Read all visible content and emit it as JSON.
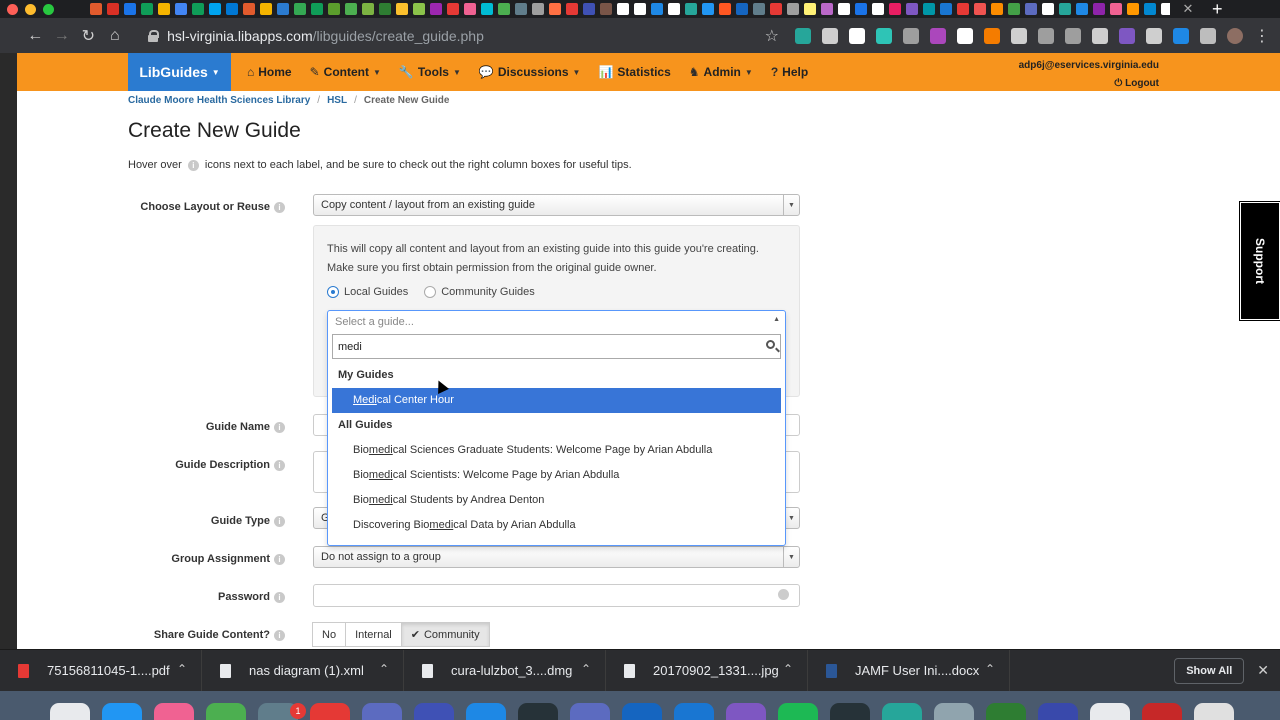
{
  "browser": {
    "url_host": "hsl-virginia.libapps.com",
    "url_path": "/libguides/create_guide.php",
    "tab_favicon_colors": [
      "#e25b2d",
      "#d93025",
      "#1a73e8",
      "#0f9d58",
      "#f4b400",
      "#4285f4",
      "#0f9d58",
      "#00a4ef",
      "#0078d4",
      "#e25b2d",
      "#f4b400",
      "#2b7bd0",
      "#34a853",
      "#0f9d58",
      "#5b9e2c",
      "#4caf50",
      "#7cb342",
      "#2e7d32",
      "#fbc02d",
      "#8bc34a",
      "#9c27b0",
      "#e53935",
      "#f06292",
      "#00bcd4",
      "#4caf50",
      "#607d8b",
      "#9e9e9e",
      "#ff7043",
      "#e53935",
      "#3f51b5",
      "#795548",
      "#ffffff",
      "#ffffff",
      "#1e88e5",
      "#ffffff",
      "#26a69a",
      "#2196f3",
      "#ff5722",
      "#1565c0",
      "#607d8b",
      "#e53935",
      "#9e9e9e",
      "#fff176",
      "#ba68c8",
      "#ffffff",
      "#1a73e8",
      "#ffffff",
      "#e91e63",
      "#7e57c2",
      "#0097a7",
      "#1976d2",
      "#e53935",
      "#ef5350",
      "#fb8c00",
      "#43a047",
      "#5c6bc0",
      "#ffffff",
      "#26a69a",
      "#1e88e5",
      "#8e24aa",
      "#f06292",
      "#ff9800",
      "#0288d1",
      "#ffffff",
      "#1e88e5",
      "#1a73e8",
      "#00897b",
      "#ffffff",
      "#ef5350",
      "#2e7d32",
      "#d32f2f",
      "#ffffff",
      "#5c6bc0"
    ],
    "extension_colors": [
      "#26a69a",
      "#cfcfcf",
      "#ffffff",
      "#2ec4b6",
      "#9e9e9e",
      "#ab47bc",
      "#ffffff",
      "#f57c00",
      "#cfcfcf",
      "#9e9e9e",
      "#9e9e9e",
      "#cfcfcf",
      "#7e57c2",
      "#cfcfcf",
      "#1e88e5",
      "#bdbdbd"
    ]
  },
  "navbar": {
    "brand": "LibGuides",
    "items": [
      {
        "icon": "home-icon",
        "glyph": "⌂",
        "label": "Home",
        "caret": false
      },
      {
        "icon": "content-icon",
        "glyph": "✎",
        "label": "Content",
        "caret": true
      },
      {
        "icon": "wrench-icon",
        "glyph": "🔧",
        "label": "Tools",
        "caret": true
      },
      {
        "icon": "discussions-icon",
        "glyph": "💬",
        "label": "Discussions",
        "caret": true
      },
      {
        "icon": "statistics-icon",
        "glyph": "📊",
        "label": "Statistics",
        "caret": false
      },
      {
        "icon": "admin-icon",
        "glyph": "♞",
        "label": "Admin",
        "caret": true
      },
      {
        "icon": "help-icon",
        "glyph": "?",
        "label": "Help",
        "caret": false
      }
    ],
    "user_email": "adp6j@eservices.virginia.edu",
    "logout": "Logout"
  },
  "breadcrumb": [
    "Claude Moore Health Sciences Library",
    "HSL",
    "Create New Guide"
  ],
  "page_title": "Create New Guide",
  "intro": {
    "before": "Hover over",
    "after": "icons next to each label, and be sure to check out the right column boxes for useful tips."
  },
  "form": {
    "layout_label": "Choose Layout or Reuse",
    "layout_value": "Copy content / layout from an existing guide",
    "copy_note": "This will copy all content and layout from an existing guide into this guide you're creating. Make sure you first obtain permission from the original guide owner.",
    "radio_local": "Local Guides",
    "radio_community": "Community Guides",
    "guide_name_label": "Guide Name",
    "guide_desc_label": "Guide Description",
    "guide_type_label": "Guide Type",
    "guide_type_partial": "G",
    "group_label": "Group Assignment",
    "group_value": "Do not assign to a group",
    "password_label": "Password",
    "share_label": "Share Guide Content?",
    "share_options": [
      "No",
      "Internal",
      "Community"
    ],
    "share_selected": "Community"
  },
  "dropdown": {
    "placeholder": "Select a guide...",
    "search_value": "medi",
    "groups": [
      {
        "label": "My Guides",
        "options": [
          {
            "pre": "",
            "match": "Medi",
            "post": "cal Center Hour",
            "selected": true
          }
        ]
      },
      {
        "label": "All Guides",
        "options": [
          {
            "pre": "Bio",
            "match": "medi",
            "post": "cal Sciences Graduate Students: Welcome Page by Arian Abdulla",
            "selected": false
          },
          {
            "pre": "Bio",
            "match": "medi",
            "post": "cal Scientists: Welcome Page by Arian Abdulla",
            "selected": false
          },
          {
            "pre": "Bio",
            "match": "medi",
            "post": "cal Students by Andrea Denton",
            "selected": false
          },
          {
            "pre": "Discovering Bio",
            "match": "medi",
            "post": "cal Data by Arian Abdulla",
            "selected": false
          }
        ]
      }
    ]
  },
  "support_tab": "Support",
  "downloads": {
    "items": [
      {
        "name": "75156811045-1....pdf",
        "kind": "pdf"
      },
      {
        "name": "nas diagram (1).xml",
        "kind": "file"
      },
      {
        "name": "cura-lulzbot_3....dmg",
        "kind": "file"
      },
      {
        "name": "20170902_1331....jpg",
        "kind": "file"
      },
      {
        "name": "JAMF User Ini....docx",
        "kind": "word"
      }
    ],
    "show_all": "Show All"
  },
  "dock": {
    "badge": "1",
    "icon_colors": [
      "#e8eaed",
      "#2196f3",
      "#f06292",
      "#4caf50",
      "#607d8b",
      "#e53935",
      "#5c6bc0",
      "#3f51b5",
      "#1e88e5",
      "#263238",
      "#5c6bc0",
      "#1565c0",
      "#1976d2",
      "#7e57c2",
      "#1db954",
      "#263238",
      "#26a69a",
      "#90a4ae",
      "#2e7d32",
      "#3949ab",
      "#e8eaed",
      "#c62828",
      "#e0e0e0"
    ]
  }
}
